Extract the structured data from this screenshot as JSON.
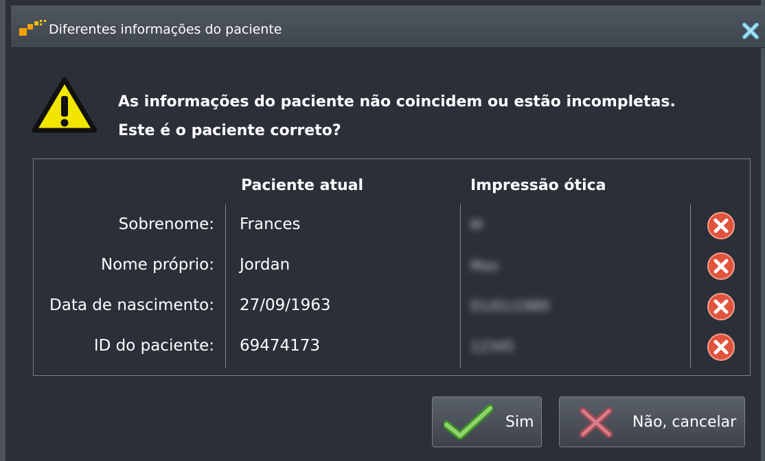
{
  "window": {
    "title": "Diferentes informações do paciente"
  },
  "message": {
    "line1": "As informações do paciente não coincidem ou estão incompletas.",
    "line2": "Este é o paciente correto?"
  },
  "table": {
    "headers": [
      "Paciente atual",
      "Impressão ótica"
    ],
    "rows": [
      {
        "label": "Sobrenome:",
        "current": "Frances",
        "optical": "M",
        "status": "mismatch"
      },
      {
        "label": "Nome próprio:",
        "current": "Jordan",
        "optical": "Max",
        "status": "mismatch"
      },
      {
        "label": "Data de nascimento:",
        "current": "27/09/1963",
        "optical": "01/01/1980",
        "status": "mismatch"
      },
      {
        "label": "ID do paciente:",
        "current": "69474173",
        "optical": "12345",
        "status": "mismatch"
      }
    ]
  },
  "buttons": {
    "yes_label": "Sim",
    "no_label": "Não, cancelar"
  },
  "colors": {
    "background": "#2b2f38",
    "titlebar": "#474d56",
    "warning_yellow": "#f2e600",
    "error_red": "#e0533c",
    "check_green": "#6fc24a"
  },
  "icons": {
    "app": "app-logo-icon",
    "close": "close-icon",
    "warning": "warning-icon",
    "error": "error-icon",
    "check": "checkmark-icon",
    "cancel": "cancel-x-icon"
  }
}
